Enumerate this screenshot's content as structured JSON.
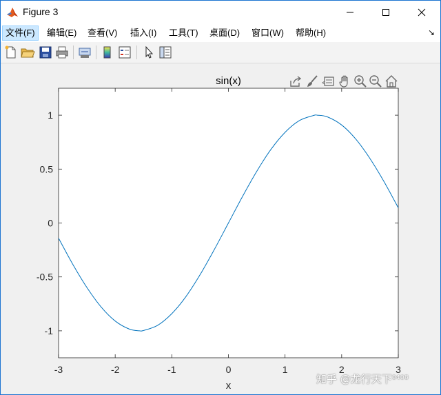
{
  "window": {
    "title": "Figure 3"
  },
  "menu": {
    "items": [
      {
        "label": "文件(F)"
      },
      {
        "label": "编辑(E)"
      },
      {
        "label": "查看(V)"
      },
      {
        "label": "插入(I)"
      },
      {
        "label": "工具(T)"
      },
      {
        "label": "桌面(D)"
      },
      {
        "label": "窗口(W)"
      },
      {
        "label": "帮助(H)"
      }
    ],
    "active_index": 0
  },
  "toolbar": {
    "icons": [
      "new-file-icon",
      "open-folder-icon",
      "save-icon",
      "print-icon",
      "link-plot-icon",
      "colorbar-icon",
      "legend-icon",
      "select-pointer-icon",
      "property-inspector-icon"
    ]
  },
  "axes_toolbar": {
    "icons": [
      "export-icon",
      "brush-icon",
      "data-tips-icon",
      "pan-hand-icon",
      "zoom-in-icon",
      "zoom-out-icon",
      "restore-view-icon"
    ]
  },
  "watermark": "知乎 @龙行天下⁰⁴⁰⁸",
  "chart_data": {
    "type": "line",
    "title": "sin(x)",
    "xlabel": "x",
    "ylabel": "",
    "xlim": [
      -3,
      3
    ],
    "ylim": [
      -1.25,
      1.25
    ],
    "xticks": [
      -3,
      -2,
      -1,
      0,
      1,
      2,
      3
    ],
    "yticks": [
      -1,
      -0.5,
      0,
      0.5,
      1
    ],
    "ytick_labels": [
      "-1",
      "-0.5",
      "0",
      "0.5",
      "1"
    ],
    "xtick_labels": [
      "-3",
      "-2",
      "-1",
      "0",
      "1",
      "2",
      "3"
    ],
    "grid": false,
    "series": [
      {
        "color": "#0072bd",
        "x": [
          -3,
          -2.75,
          -2.5,
          -2.25,
          -2,
          -1.75,
          -1.5708,
          -1.5,
          -1.25,
          -1,
          -0.75,
          -0.5,
          -0.25,
          0,
          0.25,
          0.5,
          0.75,
          1,
          1.25,
          1.5,
          1.5708,
          1.75,
          2,
          2.25,
          2.5,
          2.75,
          3
        ],
        "y": [
          -0.141,
          -0.382,
          -0.598,
          -0.778,
          -0.909,
          -0.984,
          -1.0,
          -0.997,
          -0.949,
          -0.841,
          -0.682,
          -0.479,
          -0.247,
          0,
          0.247,
          0.479,
          0.682,
          0.841,
          0.949,
          0.997,
          1.0,
          0.984,
          0.909,
          0.778,
          0.598,
          0.382,
          0.141
        ]
      }
    ]
  }
}
